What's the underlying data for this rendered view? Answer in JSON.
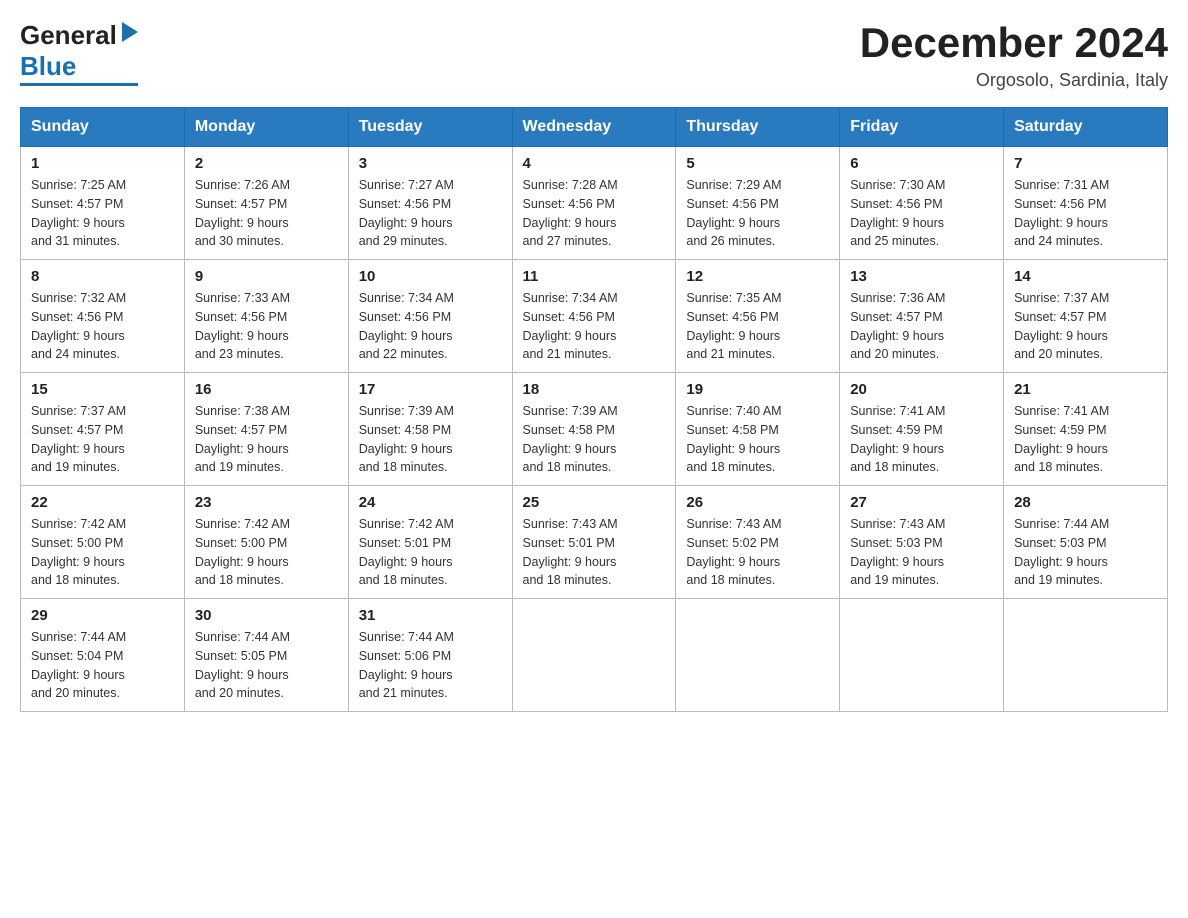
{
  "header": {
    "logo_general": "General",
    "logo_blue": "Blue",
    "title": "December 2024",
    "location": "Orgosolo, Sardinia, Italy"
  },
  "days_of_week": [
    "Sunday",
    "Monday",
    "Tuesday",
    "Wednesday",
    "Thursday",
    "Friday",
    "Saturday"
  ],
  "weeks": [
    [
      {
        "day": "1",
        "sunrise": "7:25 AM",
        "sunset": "4:57 PM",
        "daylight": "9 hours and 31 minutes."
      },
      {
        "day": "2",
        "sunrise": "7:26 AM",
        "sunset": "4:57 PM",
        "daylight": "9 hours and 30 minutes."
      },
      {
        "day": "3",
        "sunrise": "7:27 AM",
        "sunset": "4:56 PM",
        "daylight": "9 hours and 29 minutes."
      },
      {
        "day": "4",
        "sunrise": "7:28 AM",
        "sunset": "4:56 PM",
        "daylight": "9 hours and 27 minutes."
      },
      {
        "day": "5",
        "sunrise": "7:29 AM",
        "sunset": "4:56 PM",
        "daylight": "9 hours and 26 minutes."
      },
      {
        "day": "6",
        "sunrise": "7:30 AM",
        "sunset": "4:56 PM",
        "daylight": "9 hours and 25 minutes."
      },
      {
        "day": "7",
        "sunrise": "7:31 AM",
        "sunset": "4:56 PM",
        "daylight": "9 hours and 24 minutes."
      }
    ],
    [
      {
        "day": "8",
        "sunrise": "7:32 AM",
        "sunset": "4:56 PM",
        "daylight": "9 hours and 24 minutes."
      },
      {
        "day": "9",
        "sunrise": "7:33 AM",
        "sunset": "4:56 PM",
        "daylight": "9 hours and 23 minutes."
      },
      {
        "day": "10",
        "sunrise": "7:34 AM",
        "sunset": "4:56 PM",
        "daylight": "9 hours and 22 minutes."
      },
      {
        "day": "11",
        "sunrise": "7:34 AM",
        "sunset": "4:56 PM",
        "daylight": "9 hours and 21 minutes."
      },
      {
        "day": "12",
        "sunrise": "7:35 AM",
        "sunset": "4:56 PM",
        "daylight": "9 hours and 21 minutes."
      },
      {
        "day": "13",
        "sunrise": "7:36 AM",
        "sunset": "4:57 PM",
        "daylight": "9 hours and 20 minutes."
      },
      {
        "day": "14",
        "sunrise": "7:37 AM",
        "sunset": "4:57 PM",
        "daylight": "9 hours and 20 minutes."
      }
    ],
    [
      {
        "day": "15",
        "sunrise": "7:37 AM",
        "sunset": "4:57 PM",
        "daylight": "9 hours and 19 minutes."
      },
      {
        "day": "16",
        "sunrise": "7:38 AM",
        "sunset": "4:57 PM",
        "daylight": "9 hours and 19 minutes."
      },
      {
        "day": "17",
        "sunrise": "7:39 AM",
        "sunset": "4:58 PM",
        "daylight": "9 hours and 18 minutes."
      },
      {
        "day": "18",
        "sunrise": "7:39 AM",
        "sunset": "4:58 PM",
        "daylight": "9 hours and 18 minutes."
      },
      {
        "day": "19",
        "sunrise": "7:40 AM",
        "sunset": "4:58 PM",
        "daylight": "9 hours and 18 minutes."
      },
      {
        "day": "20",
        "sunrise": "7:41 AM",
        "sunset": "4:59 PM",
        "daylight": "9 hours and 18 minutes."
      },
      {
        "day": "21",
        "sunrise": "7:41 AM",
        "sunset": "4:59 PM",
        "daylight": "9 hours and 18 minutes."
      }
    ],
    [
      {
        "day": "22",
        "sunrise": "7:42 AM",
        "sunset": "5:00 PM",
        "daylight": "9 hours and 18 minutes."
      },
      {
        "day": "23",
        "sunrise": "7:42 AM",
        "sunset": "5:00 PM",
        "daylight": "9 hours and 18 minutes."
      },
      {
        "day": "24",
        "sunrise": "7:42 AM",
        "sunset": "5:01 PM",
        "daylight": "9 hours and 18 minutes."
      },
      {
        "day": "25",
        "sunrise": "7:43 AM",
        "sunset": "5:01 PM",
        "daylight": "9 hours and 18 minutes."
      },
      {
        "day": "26",
        "sunrise": "7:43 AM",
        "sunset": "5:02 PM",
        "daylight": "9 hours and 18 minutes."
      },
      {
        "day": "27",
        "sunrise": "7:43 AM",
        "sunset": "5:03 PM",
        "daylight": "9 hours and 19 minutes."
      },
      {
        "day": "28",
        "sunrise": "7:44 AM",
        "sunset": "5:03 PM",
        "daylight": "9 hours and 19 minutes."
      }
    ],
    [
      {
        "day": "29",
        "sunrise": "7:44 AM",
        "sunset": "5:04 PM",
        "daylight": "9 hours and 20 minutes."
      },
      {
        "day": "30",
        "sunrise": "7:44 AM",
        "sunset": "5:05 PM",
        "daylight": "9 hours and 20 minutes."
      },
      {
        "day": "31",
        "sunrise": "7:44 AM",
        "sunset": "5:06 PM",
        "daylight": "9 hours and 21 minutes."
      },
      null,
      null,
      null,
      null
    ]
  ],
  "labels": {
    "sunrise": "Sunrise:",
    "sunset": "Sunset:",
    "daylight": "Daylight:"
  },
  "colors": {
    "header_bg": "#2a7abf",
    "accent_blue": "#1a6faf"
  }
}
